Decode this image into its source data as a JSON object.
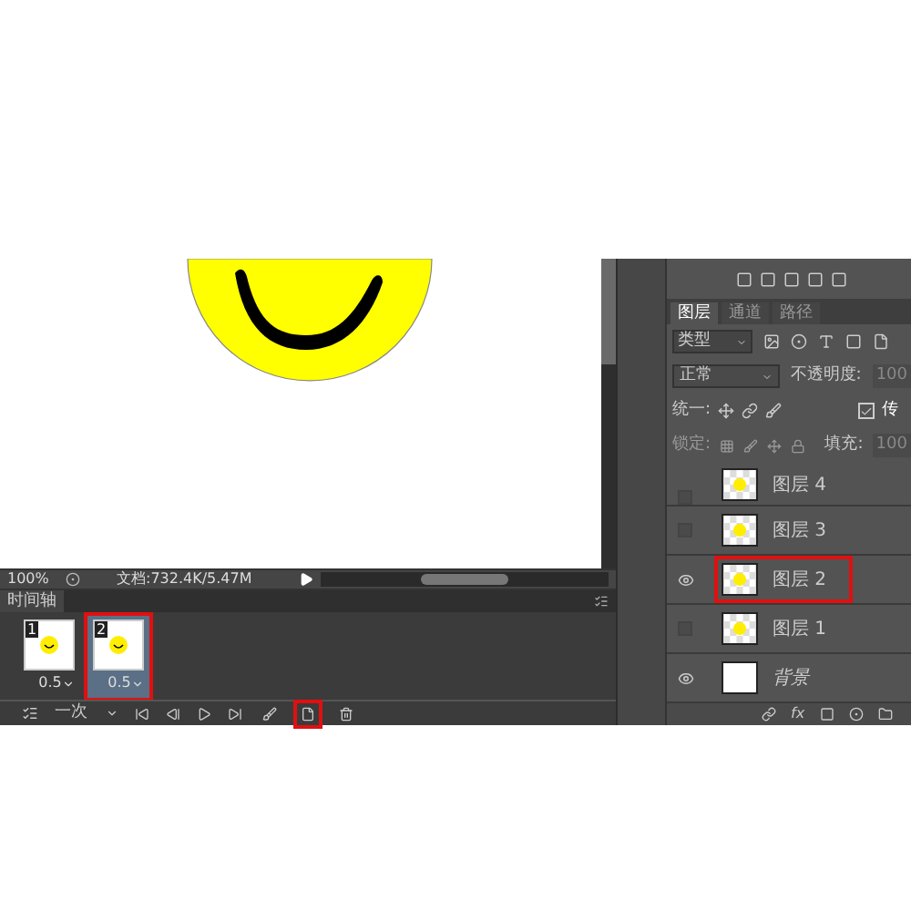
{
  "status": {
    "zoom": "100%",
    "doc_info": "文档:732.4K/5.47M"
  },
  "timeline": {
    "title": "时间轴",
    "frames": [
      {
        "number": "1",
        "delay": "0.5",
        "selected": false,
        "highlighted": false
      },
      {
        "number": "2",
        "delay": "0.5",
        "selected": true,
        "highlighted": true
      }
    ],
    "loop": "一次",
    "tools": [
      {
        "kind": "tween",
        "highlighted": false
      },
      {
        "kind": "new-frame",
        "highlighted": true
      },
      {
        "kind": "delete",
        "highlighted": false
      }
    ]
  },
  "layers_panel": {
    "tabs": [
      {
        "label": "图层",
        "selected": true
      },
      {
        "label": "通道",
        "selected": false
      },
      {
        "label": "路径",
        "selected": false
      }
    ],
    "filter": "类型",
    "blend_mode": "正常",
    "opacity_label": "不透明度:",
    "opacity_value": "100",
    "unify_label": "统一:",
    "propagate": {
      "label": "传",
      "checked": true
    },
    "style_label": "fx",
    "lock_label": "锁定:",
    "fill_label": "填充:",
    "fill_value": "100",
    "layers": [
      {
        "name": "图层 4",
        "kind": "smiley",
        "visible": false,
        "selected": false,
        "highlighted": false
      },
      {
        "name": "图层 3",
        "kind": "smiley",
        "visible": false,
        "selected": false,
        "highlighted": false
      },
      {
        "name": "图层 2",
        "kind": "smiley",
        "visible": true,
        "selected": false,
        "highlighted": true
      },
      {
        "name": "图层 1",
        "kind": "smiley",
        "visible": false,
        "selected": false,
        "highlighted": false
      },
      {
        "name": "背景",
        "kind": "background",
        "visible": true,
        "selected": false,
        "highlighted": false
      }
    ]
  }
}
